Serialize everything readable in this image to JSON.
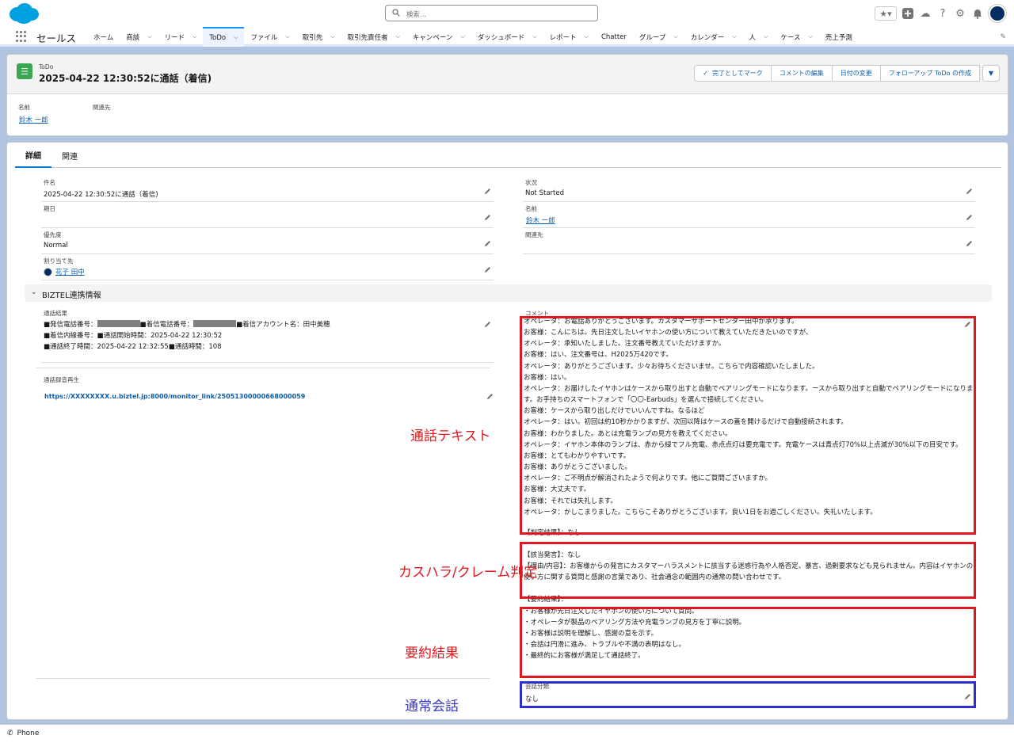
{
  "search": {
    "placeholder": "検索..."
  },
  "nav": {
    "app_name": "セールス",
    "items": [
      {
        "label": "ホーム",
        "chevron": false
      },
      {
        "label": "商談",
        "chevron": true
      },
      {
        "label": "リード",
        "chevron": true
      },
      {
        "label": "ToDo",
        "chevron": true,
        "active": true
      },
      {
        "label": "ファイル",
        "chevron": true
      },
      {
        "label": "取引先",
        "chevron": true
      },
      {
        "label": "取引先責任者",
        "chevron": true
      },
      {
        "label": "キャンペーン",
        "chevron": true
      },
      {
        "label": "ダッシュボード",
        "chevron": true
      },
      {
        "label": "レポート",
        "chevron": true
      },
      {
        "label": "Chatter",
        "chevron": false
      },
      {
        "label": "グループ",
        "chevron": true
      },
      {
        "label": "カレンダー",
        "chevron": true
      },
      {
        "label": "人",
        "chevron": true
      },
      {
        "label": "ケース",
        "chevron": true
      },
      {
        "label": "売上予測",
        "chevron": false
      }
    ]
  },
  "header": {
    "object_type": "ToDo",
    "title": "2025-04-22 12:30:52に通話（着信)",
    "buttons": {
      "mark_complete": "完了としてマーク",
      "edit_comment": "コメントの編集",
      "change_date": "日付の変更",
      "create_followup": "フォローアップ ToDo の作成"
    },
    "name_label": "名前",
    "name_value": "鈴木 一郎",
    "related_label": "関連先"
  },
  "tabs": {
    "details": "詳細",
    "related": "関連"
  },
  "fields": {
    "subject_label": "件名",
    "subject_value": "2025-04-22 12:30:52に通話（着信)",
    "due_label": "期日",
    "priority_label": "優先度",
    "priority_value": "Normal",
    "assigned_label": "割り当て先",
    "assigned_value": "花子 田中",
    "status_label": "状況",
    "status_value": "Not Started",
    "name_label": "名前",
    "name_value": "鈴木 一郎",
    "related_label": "関連先"
  },
  "section": {
    "title": "BIZTEL連携情報"
  },
  "call": {
    "result_label": "通話結果",
    "line1a": "■発信電話番号：",
    "line1b": "■着信電話番号：",
    "line1c": "■着信アカウント名：田中美穂",
    "line2": "■着信内線番号：■通話開始時間：2025-04-22 12:30:52",
    "line3": "■通話終了時間：2025-04-22 12:32:55■通話時間：108",
    "playback_label": "通話録音再生",
    "playback_link": "https://XXXXXXXX.u.biztel.jp:8000/monitor_link/25051300000668000059"
  },
  "comment": {
    "label": "コメント",
    "transcript": [
      "オペレータ：お電話ありがとうございます。カスタマーサポートセンター田中が承ります。",
      "お客様：こんにちは。先日注文したいイヤホンの使い方について教えていただきたいのですが、",
      "オペレータ：承知いたしました。注文番号教えていただけますか。",
      "お客様：はい、注文番号は、H2025万420です。",
      "オペレータ：ありがとうございます。少々お待ちくださいませ。こちらで内容確認いたしました。",
      "お客様：はい。",
      "オペレータ：お届けしたイヤホンはケースから取り出すと自動でペアリングモードになります。ースから取り出すと自動でペアリングモードになります。お手持ちのスマートフォンで「〇〇-Earbuds」を選んで接続してください。",
      "お客様：ケースから取り出しだけでいいんですね。なるほど",
      "オペレータ：はい。初回は約10秒かかりますが、次回以降はケースの蓋を開けるだけで自動接続されます。",
      "お客様：わかりました。あとは充電ランプの見方を教えてください。",
      "オペレータ：イヤホン本体のランプは、赤から緑でフル充電、赤点点灯は要充電です。充電ケースは青点灯70%以上点滅が30%以下の目安です。",
      "お客様：とてもわかりやすいです。",
      "お客様：ありがとうございました。",
      "オペレータ：ご不明点が解消されたようで何よりです。他にご質問ございますか。",
      "お客様：大丈夫です。",
      "お客様：それでは失礼します。",
      "オペレータ：かしこまりました。こちらこそありがとうございます。良い1日をお過ごしください。失礼いたします。"
    ],
    "judgement": [
      "【判定結果】：なし",
      "",
      "【該当発言】：なし",
      "【理由/内容】：お客様からの発言にカスタマーハラスメントに該当する迷惑行為や人格否定、暴言、過剰要求なども見られません。内容はイヤホンの使い方に関する質問と感謝の言葉であり、社会通念の範囲内の通常の問い合わせです。"
    ],
    "summary": [
      "【要約結果】：",
      "・お客様が先日注文したイヤホンの使い方について質問。",
      "・オペレータが製品のペアリング方法や充電ランプの見方を丁寧に説明。",
      "・お客様は説明を理解し、感謝の意を示す。",
      "・会話は円滑に進み、トラブルや不満の表明はなし。",
      "・最終的にお客様が満足して通話終了。"
    ]
  },
  "classification": {
    "label": "会話分類",
    "value": "なし"
  },
  "annotations": {
    "transcript": "通話テキスト",
    "judgement": "カスハラ/クレーム判定",
    "summary": "要約結果",
    "normal": "通常会話"
  },
  "footer": {
    "phone": "Phone"
  },
  "colors": {
    "brand": "#0176d3",
    "annotation_red": "#e0171f",
    "annotation_blue": "#3535c8",
    "task_green": "#3ba755"
  }
}
